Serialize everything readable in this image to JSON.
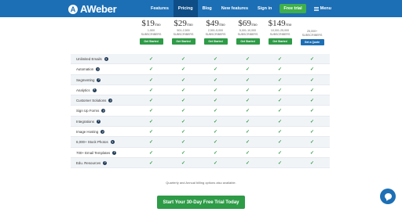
{
  "header": {
    "logo_text": "AWeber",
    "logo_icon": "aweber-logo-icon",
    "nav": [
      {
        "label": "Features"
      },
      {
        "label": "Pricing",
        "active": true
      },
      {
        "label": "Blog"
      },
      {
        "label": "New features"
      },
      {
        "label": "Sign in"
      }
    ],
    "trial_label": "Free trial",
    "menu_label": "Menu",
    "brand_color": "#1c6fb5",
    "accent_color": "#3fb04b"
  },
  "plans": [
    {
      "price": "$19",
      "per": "/mo",
      "range": "1-500",
      "subs_label": "SUBSCRIBERS",
      "button": "Get Started"
    },
    {
      "price": "$29",
      "per": "/mo",
      "range": "501-2,500",
      "subs_label": "SUBSCRIBERS",
      "button": "Get Started"
    },
    {
      "price": "$49",
      "per": "/mo",
      "range": "2,501-5,000",
      "subs_label": "SUBSCRIBERS",
      "button": "Get Started"
    },
    {
      "price": "$69",
      "per": "/mo",
      "range": "5,001-10,000",
      "subs_label": "SUBSCRIBERS",
      "button": "Get Started"
    },
    {
      "price": "$149",
      "per": "/mo",
      "range": "10,001-25,000",
      "subs_label": "SUBSCRIBERS",
      "button": "Get Started"
    },
    {
      "price": "",
      "per": "",
      "range": "25,000+",
      "subs_label": "SUBSCRIBERS",
      "button": "Get a Quote"
    }
  ],
  "features": [
    "Unlimited Emails",
    "Automation",
    "Segmenting",
    "Analytics",
    "Customer Solutions",
    "Sign Up Forms",
    "Integrations",
    "Image Hosting",
    "6,000+ Stock Photos",
    "700+ Email Templates",
    "Edu. Resources"
  ],
  "check_glyph": "✓",
  "help_glyph": "?",
  "billing_note": "Quarterly and Annual billing options also available.",
  "cta_label": "Start Your 30-Day Free Trial Today",
  "chat_icon": "chat-bubble-icon"
}
